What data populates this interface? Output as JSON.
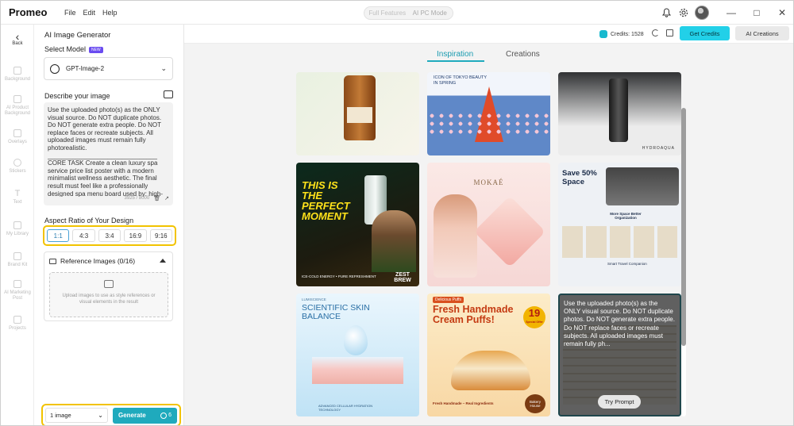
{
  "app": {
    "name": "Promeo",
    "menu": [
      "File",
      "Edit",
      "Help"
    ],
    "modes": [
      "Full Features",
      "AI PC Mode"
    ]
  },
  "rail": {
    "back": "Back",
    "items": [
      "Background",
      "AI Product Background",
      "Overlays",
      "Stickers",
      "Text",
      "My Library",
      "Brand Kit",
      "AI Marketing Post",
      "Projects"
    ]
  },
  "panel": {
    "title": "AI Image Generator",
    "select_model_label": "Select Model",
    "new_badge": "NEW",
    "model": "GPT-Image-2",
    "describe_label": "Describe your image",
    "prompt_text": "Use the uploaded photo(s) as the ONLY visual source. Do NOT duplicate photos. Do NOT generate extra people. Do NOT replace faces or recreate subjects. All uploaded images must remain fully photorealistic.\n_______________________________\nCORE TASK Create a clean luxury spa service price list poster with a modern minimalist wellness aesthetic. The final result must feel like a professionally designed spa menu board used by: high-end massage spas facial treatment salons wellness centers hotel spas beauty therapy",
    "char_count": "3925 / 8000",
    "aspect_label": "Aspect Ratio of Your Design",
    "ratios": [
      "1:1",
      "4:3",
      "3:4",
      "16:9",
      "9:16"
    ],
    "selected_ratio": "1:1",
    "reference_label": "Reference Images (0/16)",
    "upload_hint": "Upload images to use as style references or visual elements in the result",
    "count_select": "1 image",
    "generate": "Generate",
    "generate_cost": "6"
  },
  "topbar": {
    "credits": "Credits: 1528",
    "get_credits": "Get Credits",
    "ai_creations": "AI Creations"
  },
  "tabs": {
    "inspiration": "Inspiration",
    "creations": "Creations"
  },
  "cards": {
    "c2_text": "ICON OF TOKYO BEAUTY IN SPRING",
    "c3_text": "HYDROAQUA",
    "c4_title": "THIS IS THE PERFECT MOMENT",
    "c4_brand": "ZEST BREW",
    "c4_tag": "ICE-COLD ENERGY • PURE REFRESHMENT",
    "c5_brand": "MOKAÉ",
    "c6_title": "Save 50% Space",
    "c6_sub": "More Space Better Organization",
    "c6_foot": "Smart Travel Companion",
    "c7_kicker": "LUMISCIENCE",
    "c7_title": "SCIENTIFIC SKIN BALANCE",
    "c7_foot": "ADVANCED CELLULAR HYDRATION TECHNOLOGY",
    "c8_kicker": "Delicious Puffs",
    "c8_title": "Fresh Handmade Cream Puffs!",
    "c8_badge": "19",
    "c8_badge_sub": "Special Offer",
    "c8_foot": "Fresh Handmade – Real Ingredients",
    "c8_brand": "Bakery House",
    "c9_overlay": "Use the uploaded photo(s) as the ONLY visual source. Do NOT duplicate photos. Do NOT generate extra people. Do NOT replace faces or recreate subjects. All uploaded images must remain fully ph...",
    "try_prompt": "Try Prompt"
  }
}
